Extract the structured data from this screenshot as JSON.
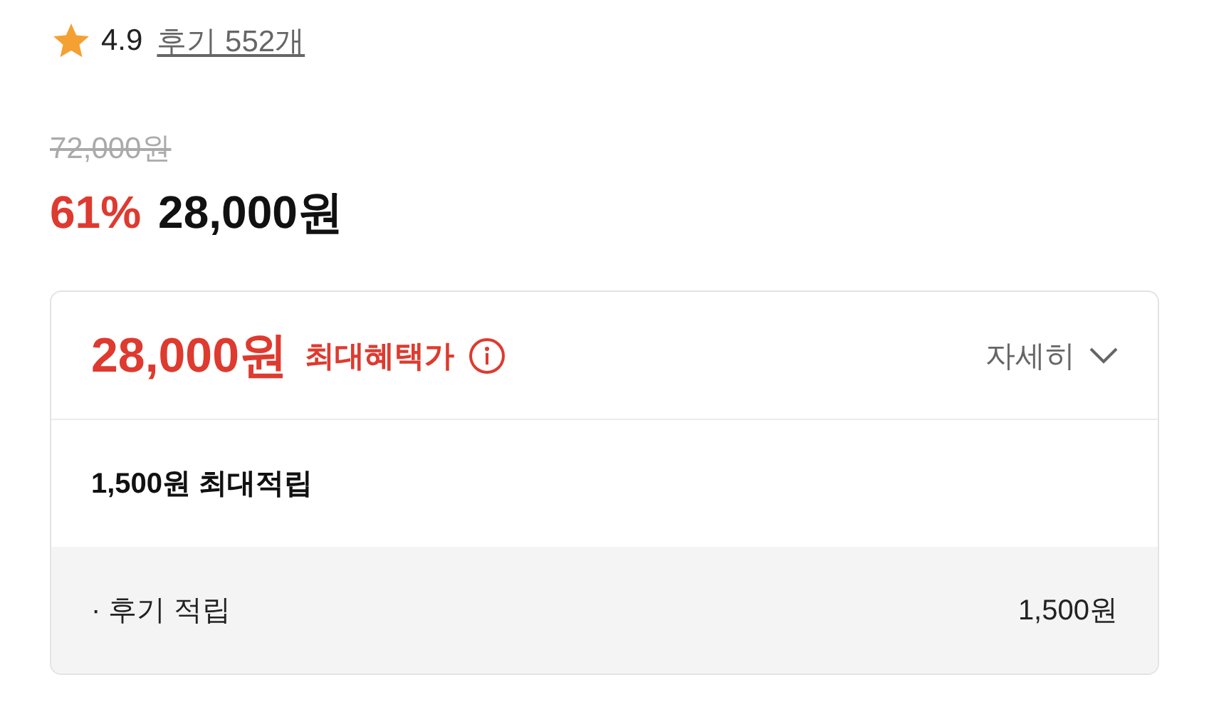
{
  "rating": {
    "score": "4.9",
    "reviews": "후기 552개"
  },
  "price": {
    "original": "72,000원",
    "discount": "61%",
    "current": "28,000원"
  },
  "benefit": {
    "price": "28,000원",
    "label": "최대혜택가",
    "details": "자세히",
    "expanded": false,
    "points_title": "1,500원 최대적립",
    "items": [
      {
        "label": "· 후기 적립",
        "amount": "1,500원"
      }
    ]
  }
}
